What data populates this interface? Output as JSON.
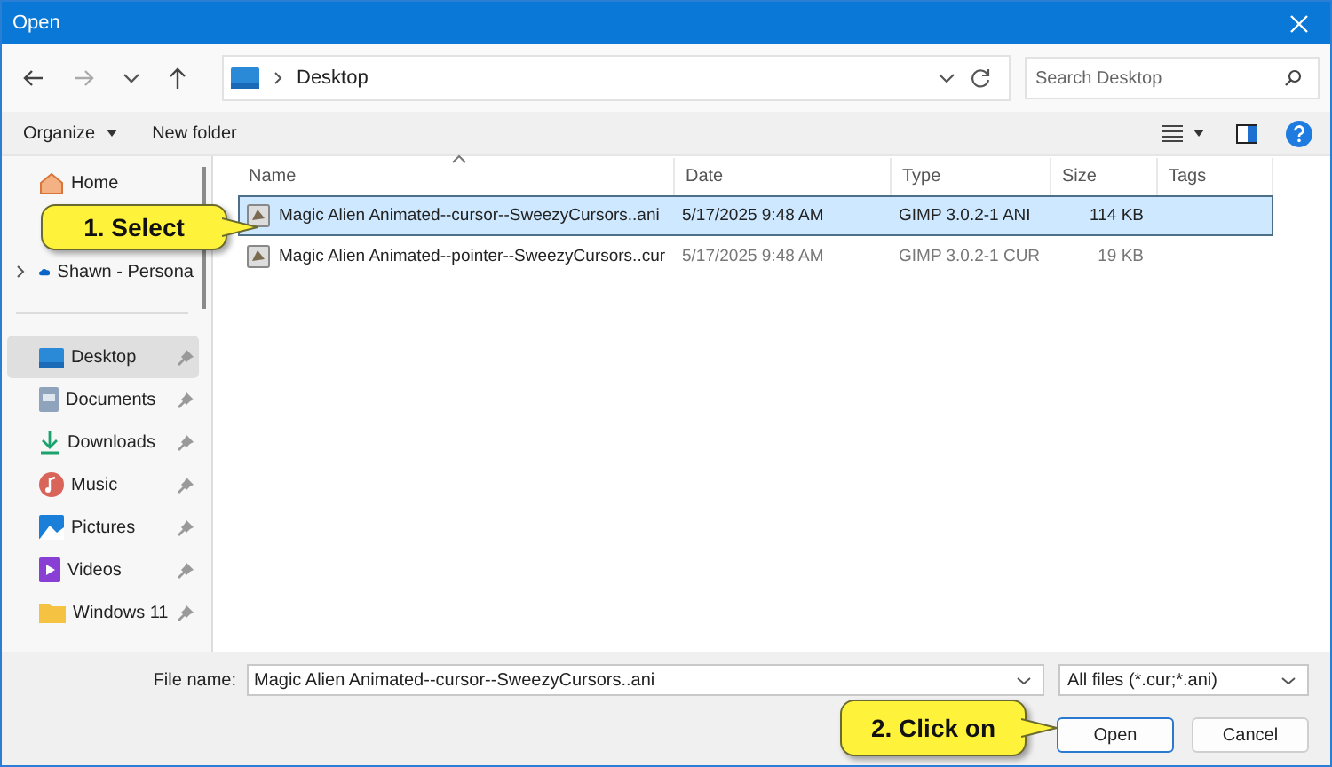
{
  "window": {
    "title": "Open"
  },
  "navigation": {
    "path": "Desktop",
    "search": {
      "placeholder": "Search Desktop"
    }
  },
  "toolbar": {
    "organize": "Organize",
    "new_folder": "New folder"
  },
  "sidebar": {
    "items": [
      {
        "label": "Home",
        "selected": false,
        "pinned": false,
        "expandable": false
      },
      {
        "label": "Shawn - Persona",
        "selected": false,
        "pinned": false,
        "expandable": true
      },
      {
        "label": "Desktop",
        "selected": true,
        "pinned": true,
        "expandable": false
      },
      {
        "label": "Documents",
        "selected": false,
        "pinned": true,
        "expandable": false
      },
      {
        "label": "Downloads",
        "selected": false,
        "pinned": true,
        "expandable": false
      },
      {
        "label": "Music",
        "selected": false,
        "pinned": true,
        "expandable": false
      },
      {
        "label": "Pictures",
        "selected": false,
        "pinned": true,
        "expandable": false
      },
      {
        "label": "Videos",
        "selected": false,
        "pinned": true,
        "expandable": false
      },
      {
        "label": "Windows 11",
        "selected": false,
        "pinned": true,
        "expandable": false
      }
    ]
  },
  "table": {
    "columns": [
      "Name",
      "Date",
      "Type",
      "Size",
      "Tags"
    ],
    "rows": [
      {
        "name": "Magic Alien Animated--cursor--SweezyCursors..ani",
        "date": "5/17/2025 9:48 AM",
        "type": "GIMP 3.0.2-1 ANI",
        "size": "114 KB",
        "selected": true
      },
      {
        "name": "Magic Alien Animated--pointer--SweezyCursors..cur",
        "date": "5/17/2025 9:48 AM",
        "type": "GIMP 3.0.2-1 CUR",
        "size": "19 KB",
        "selected": false
      }
    ]
  },
  "footer": {
    "file_name_label": "File name:",
    "file_name": "Magic Alien Animated--cursor--SweezyCursors..ani",
    "filter": "All files (*.cur;*.ani)",
    "buttons": [
      {
        "label": "Open",
        "default": true
      },
      {
        "label": "Cancel",
        "default": false
      }
    ]
  },
  "callouts": [
    {
      "text": "1. Select"
    },
    {
      "text": "2. Click on"
    }
  ]
}
